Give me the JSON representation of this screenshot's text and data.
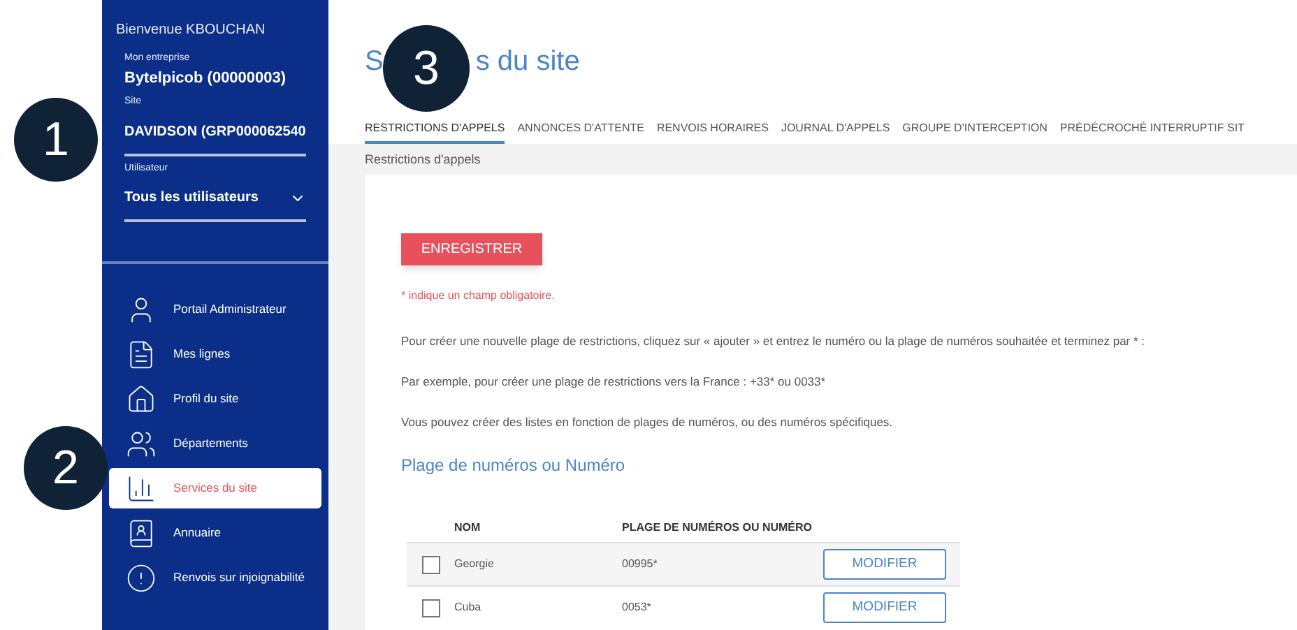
{
  "sidebar": {
    "greeting": "Bienvenue KBOUCHAN",
    "company": {
      "label": "Mon entreprise",
      "value": "Bytelpicob (00000003)"
    },
    "site": {
      "label": "Site",
      "value": "DAVIDSON (GRP000062540"
    },
    "user": {
      "label": "Utilisateur",
      "value": "Tous les utilisateurs"
    },
    "items": [
      {
        "label": "Portail Administrateur",
        "kind": "admin",
        "selected": false
      },
      {
        "label": "Mes lignes",
        "kind": "lines",
        "selected": false
      },
      {
        "label": "Profil du site",
        "kind": "home",
        "selected": false
      },
      {
        "label": "Départements",
        "kind": "users",
        "selected": false
      },
      {
        "label": "Services du site",
        "kind": "services",
        "selected": true
      },
      {
        "label": "Annuaire",
        "kind": "book",
        "selected": false
      },
      {
        "label": "Renvois sur injoignabilité",
        "kind": "alert",
        "selected": false
      }
    ]
  },
  "page_title": {
    "before": "S",
    "after": "s du site"
  },
  "tabs": [
    {
      "label": "RESTRICTIONS D'APPELS",
      "selected": true
    },
    {
      "label": "ANNONCES D'ATTENTE",
      "selected": false
    },
    {
      "label": "RENVOIS HORAIRES",
      "selected": false
    },
    {
      "label": "JOURNAL D'APPELS",
      "selected": false
    },
    {
      "label": "GROUPE D'INTERCEPTION",
      "selected": false
    },
    {
      "label": "PRÉDÉCROCHÉ INTERRUPTIF SIT",
      "selected": false
    }
  ],
  "breadcrumb": "Restrictions d'appels",
  "save_button": "ENREGISTRER",
  "required_note": "* indique un champ obligatoire.",
  "paragraphs": [
    "Pour créer une nouvelle plage de restrictions, cliquez sur « ajouter » et entrez le numéro ou la plage de numéros souhaitée et terminez par * :",
    "Par exemple, pour créer une plage de restrictions vers la France : +33* ou 0033*",
    "Vous pouvez créer des listes en fonction de plages de numéros, ou des numéros spécifiques."
  ],
  "section_title": "Plage de numéros ou Numéro",
  "table": {
    "columns": [
      "NOM",
      "PLAGE DE NUMÉROS OU NUMÉRO"
    ],
    "rows": [
      {
        "name": "Georgie",
        "range": "00995*",
        "checked": false,
        "action": "MODIFIER"
      },
      {
        "name": "Cuba",
        "range": "0053*",
        "checked": false,
        "action": "MODIFIER"
      }
    ]
  },
  "callouts": [
    "1",
    "2",
    "3"
  ]
}
